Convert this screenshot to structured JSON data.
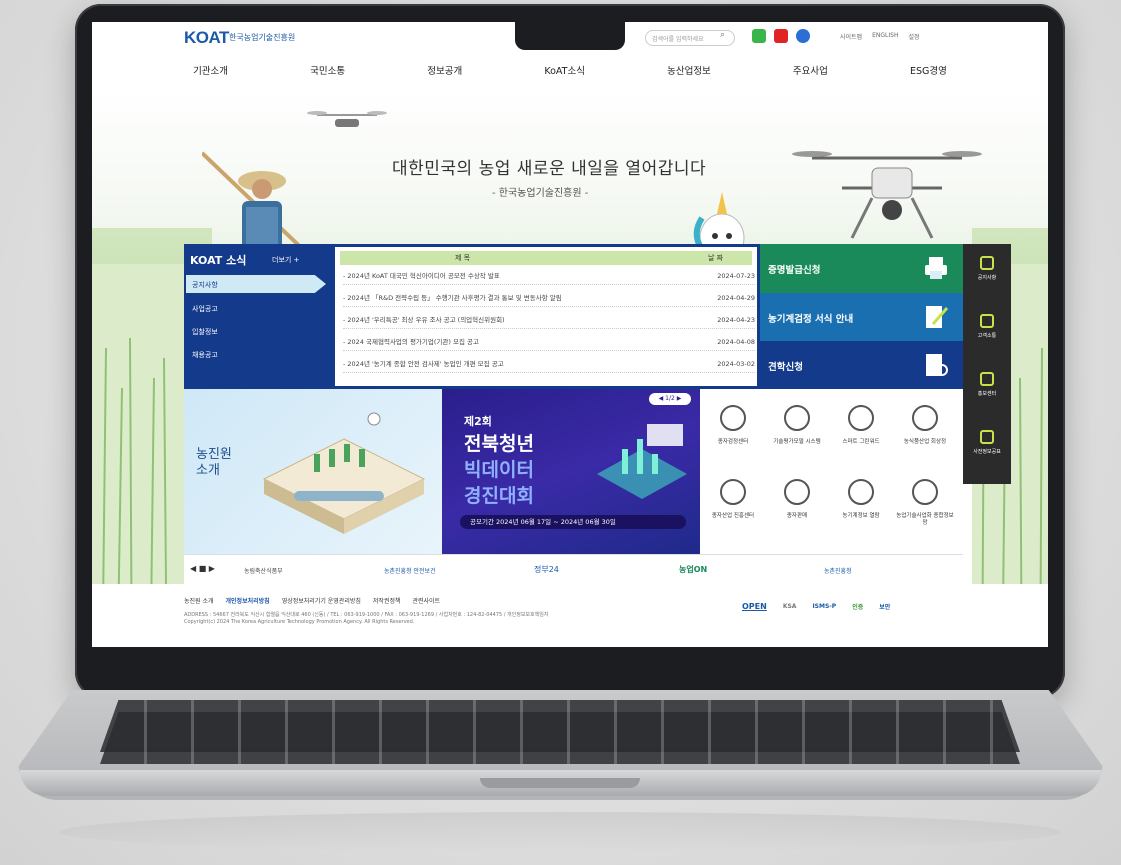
{
  "site": {
    "logo": "KOAT",
    "logo_sub": "한국농업기술진흥원",
    "search_placeholder": "검색어를 입력하세요",
    "util_links": [
      "사이트맵",
      "ENGLISH",
      "설정"
    ]
  },
  "gnb": [
    "기관소개",
    "국민소통",
    "정보공개",
    "KoAT소식",
    "농산업정보",
    "주요사업",
    "ESG경영"
  ],
  "hero": {
    "title": "대한민국의 농업 새로운 내일을 열어갑니다",
    "subtitle": "- 한국농업기술진흥원 -"
  },
  "news": {
    "title": "KOAT 소식",
    "more": "더보기 +",
    "categories": [
      "공지사항",
      "사업공고",
      "입찰정보",
      "채용공고"
    ],
    "col_title": "제   목",
    "col_date": "날   짜",
    "rows": [
      {
        "title": "- 2024년 KoAT 대국민 혁신아이디어 공모전 수상작 발표",
        "date": "2024-07-23"
      },
      {
        "title": "- 2024년 「R&D 전략수립 등」 수행기관 사후평가 결과 통보 및 변동사항 알림",
        "date": "2024-04-29"
      },
      {
        "title": "- 2024년 '우리특공' 최상 우유 조사 공고 (의업혁신위원회)",
        "date": "2024-04-23"
      },
      {
        "title": "- 2024 국제협력사업의 평가기업(기관) 모집 공고",
        "date": "2024-04-08"
      },
      {
        "title": "- 2024년 '농기계 종합 안전 검사제' 농업인 개편 모집 공고",
        "date": "2024-03-02"
      }
    ]
  },
  "quick": [
    "증명발급신청",
    "농기계검정 서식 안내",
    "견학신청"
  ],
  "side_quick": [
    "공지사항",
    "고객소통",
    "홍보센터",
    "사전정보공표"
  ],
  "intro": {
    "label1": "농진원",
    "label2": "소개"
  },
  "bigdata": {
    "pill": "◀ 1/2 ▶",
    "line1": "제2회",
    "line2": "전북청년",
    "line3": "빅데이터",
    "line4": "경진대회",
    "period": "공모기간   2024년 06월 17일 ~ 2024년 06월 30일"
  },
  "services": [
    "종자검정센터",
    "기술평가모델 시스템",
    "스마트 그린워드",
    "농식품산업 회상정",
    "종자산업 진흥센터",
    "종자판매",
    "농기계정보 열람",
    "농업기술사업화 종합정보망"
  ],
  "banner": {
    "controls": "◀ ■ ▶",
    "items": [
      "농림축산식품부",
      "농촌진흥청 안전보건",
      "정부24",
      "농업ON",
      "농촌진흥청"
    ]
  },
  "footer": {
    "links": [
      "농진원 소개",
      "개인정보처리방침",
      "영상정보처리기기 운영관리방침",
      "저작권정책",
      "관련사이트"
    ],
    "address": "ADDRESS : 54667 전라북도 익산시 함열읍 익산대로 460 (신동) / TEL : 063-919-1000 / FAX : 063-919-1269 / 사업자번호 : 124-82-04475 / 개인정보보호책임자",
    "copyright": "Copyright(c) 2024 The Korea Agriculture Technology Promotion Agency. All Rights Reserved.",
    "marks": [
      "OPEN",
      "KSA",
      "ISMS-P",
      "인증",
      "보안"
    ]
  },
  "colors": {
    "navy": "#143a8c",
    "green": "#1a8a5a",
    "blue": "#1a6fb0",
    "lime": "#c8e24a"
  }
}
